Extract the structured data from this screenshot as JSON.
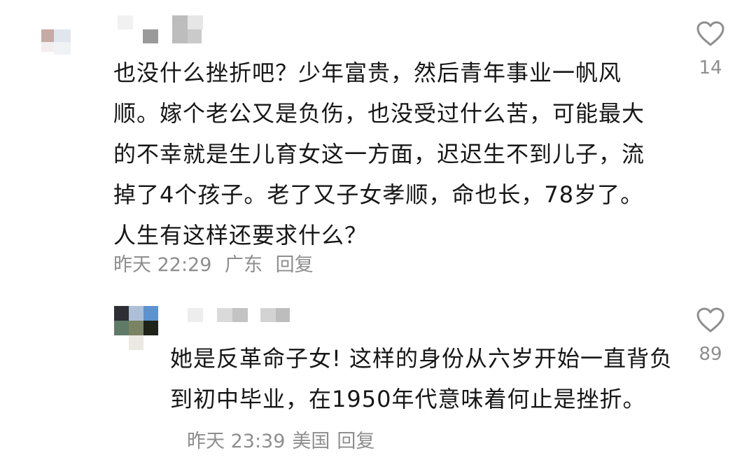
{
  "comments": [
    {
      "text": "也没什么挫折吧？少年富贵，然后青年事业一帆风顺。嫁个老公又是负伤，也没受过什么苦，可能最大的不幸就是生儿育女这一方面，迟迟生不到儿子，流掉了4个孩子。老了又子女孝顺，命也长，78岁了。人生有这样还要求什么？",
      "time": "昨天 22:29",
      "location": "广东",
      "reply_label": "回复",
      "likes": "14"
    },
    {
      "text": "她是反革命子女! 这样的身份从六岁开始一直背负到初中毕业，在1950年代意味着何止是挫折。",
      "time": "昨天 23:39",
      "location": "美国",
      "reply_label": "回复",
      "likes": "89"
    }
  ],
  "icons": {
    "like": "heart-outline-icon",
    "avatar": "pixelated-avatar"
  },
  "colors": {
    "text": "#161616",
    "meta": "#8e8e8e",
    "background": "#ffffff"
  }
}
